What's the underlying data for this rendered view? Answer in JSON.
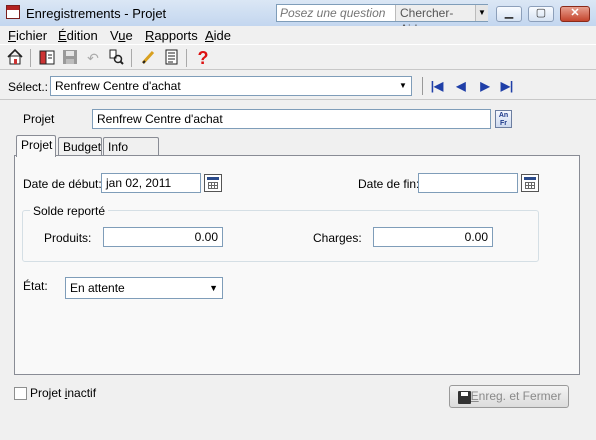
{
  "window": {
    "title": "Enregistrements - Projet",
    "help_placeholder": "Posez une question",
    "help_button": "Chercher-Aide",
    "minimize": "▭",
    "maximize": "▢",
    "close": "✕"
  },
  "menu": {
    "fichier": {
      "pre": "",
      "ul": "F",
      "post": "ichier"
    },
    "edition": {
      "pre": "",
      "ul": "É",
      "post": "dition"
    },
    "vue": {
      "pre": "V",
      "ul": "u",
      "post": "e"
    },
    "rapports": {
      "pre": "",
      "ul": "R",
      "post": "apports"
    },
    "aide": {
      "pre": "",
      "ul": "A",
      "post": "ide"
    }
  },
  "toolbar": {
    "icons": [
      "home-icon",
      "open-book-icon",
      "save-icon",
      "undo-icon",
      "find-icon",
      "edit-pencil-icon",
      "report-icon",
      "help-icon"
    ]
  },
  "select": {
    "label": "Sélect.:",
    "value": "Renfrew Centre d'achat"
  },
  "project": {
    "label": "Projet",
    "value": "Renfrew Centre d'achat",
    "lang_top": "An",
    "lang_bottom": "Fr"
  },
  "tabs": [
    {
      "label": "Projet",
      "active": true
    },
    {
      "label": "Budget",
      "active": false
    },
    {
      "label": "Info add.",
      "active": false
    }
  ],
  "form": {
    "start_label": "Date de début:",
    "start_value": "jan 02, 2011",
    "end_label": "Date de fin:",
    "end_value": "",
    "group_title": "Solde reporté",
    "revenue_label": "Produits:",
    "revenue_value": "0.00",
    "expense_label": "Charges:",
    "expense_value": "0.00",
    "status_label": "État:",
    "status_value": "En attente"
  },
  "footer": {
    "inactive_pre": "Projet ",
    "inactive_ul": "i",
    "inactive_post": "nactif",
    "inactive_checked": false,
    "save_pre": "",
    "save_ul": "E",
    "save_post": "nreg. et Fermer"
  }
}
